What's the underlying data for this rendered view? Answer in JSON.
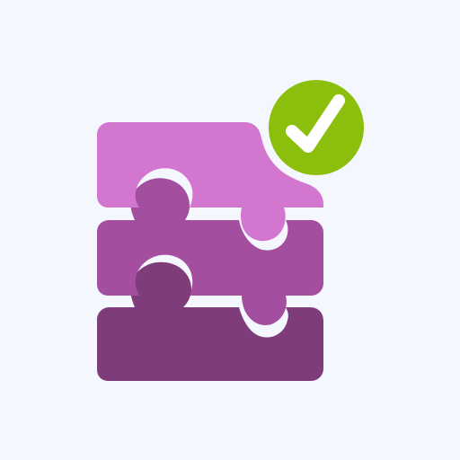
{
  "icon": {
    "name": "puzzle-stack-check-icon",
    "background_color": "#f4f8fe",
    "pieces": [
      {
        "name": "top-puzzle-piece",
        "color": "#d376cf"
      },
      {
        "name": "middle-puzzle-piece",
        "color": "#a44e9f"
      },
      {
        "name": "bottom-puzzle-piece",
        "color": "#7e3c7b"
      }
    ],
    "badge": {
      "name": "check-badge-icon",
      "color": "#8cbf0c",
      "check_color": "#ffffff"
    }
  }
}
